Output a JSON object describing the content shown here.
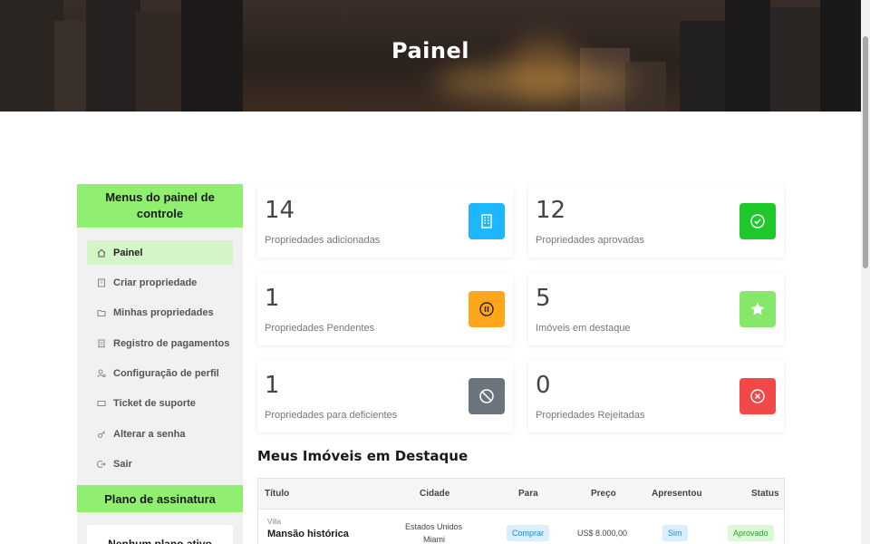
{
  "hero": {
    "title": "Painel"
  },
  "sidebar": {
    "title": "Menus do painel de controle",
    "items": [
      {
        "label": "Painel",
        "icon": "home-icon",
        "active": true
      },
      {
        "label": "Criar propriedade",
        "icon": "building-icon"
      },
      {
        "label": "Minhas propriedades",
        "icon": "folder-icon"
      },
      {
        "label": "Registro de pagamentos",
        "icon": "receipt-icon"
      },
      {
        "label": "Configuração de perfil",
        "icon": "user-gear-icon"
      },
      {
        "label": "Ticket de suporte",
        "icon": "ticket-icon"
      },
      {
        "label": "Alterar a senha",
        "icon": "key-icon"
      },
      {
        "label": "Sair",
        "icon": "logout-icon"
      }
    ],
    "plan_title": "Plano de assinatura",
    "plan_status": "Nenhum plano ativo"
  },
  "stats": [
    {
      "value": "14",
      "label": "Propriedades adicionadas",
      "color": "#1eb6ff",
      "icon": "building-icon"
    },
    {
      "value": "12",
      "label": "Propriedades aprovadas",
      "color": "#20c92b",
      "icon": "check-circle-icon"
    },
    {
      "value": "1",
      "label": "Propriedades Pendentes",
      "color": "#ffa61a",
      "icon": "pause-circle-icon"
    },
    {
      "value": "5",
      "label": "Imóveis em destaque",
      "color": "#86e86a",
      "icon": "star-icon"
    },
    {
      "value": "1",
      "label": "Propriedades para deficientes",
      "color": "#6c757d",
      "icon": "ban-icon"
    },
    {
      "value": "0",
      "label": "Propriedades Rejeitadas",
      "color": "#f24848",
      "icon": "x-circle-icon"
    }
  ],
  "featured": {
    "title": "Meus Imóveis em Destaque",
    "columns": [
      "Título",
      "Cidade",
      "Para",
      "Preço",
      "Apresentou",
      "Status"
    ],
    "rows": [
      {
        "type": "Villa",
        "title": "Mansão histórica",
        "city_line1": "Estados Unidos",
        "city_line2": "Miami",
        "for": "Comprar",
        "price": "US$ 8.000,00",
        "featured": "Sim",
        "status": "Aprovado"
      }
    ]
  },
  "colors": {
    "accent": "#90ee70",
    "active_bg": "#d3f5c8"
  }
}
